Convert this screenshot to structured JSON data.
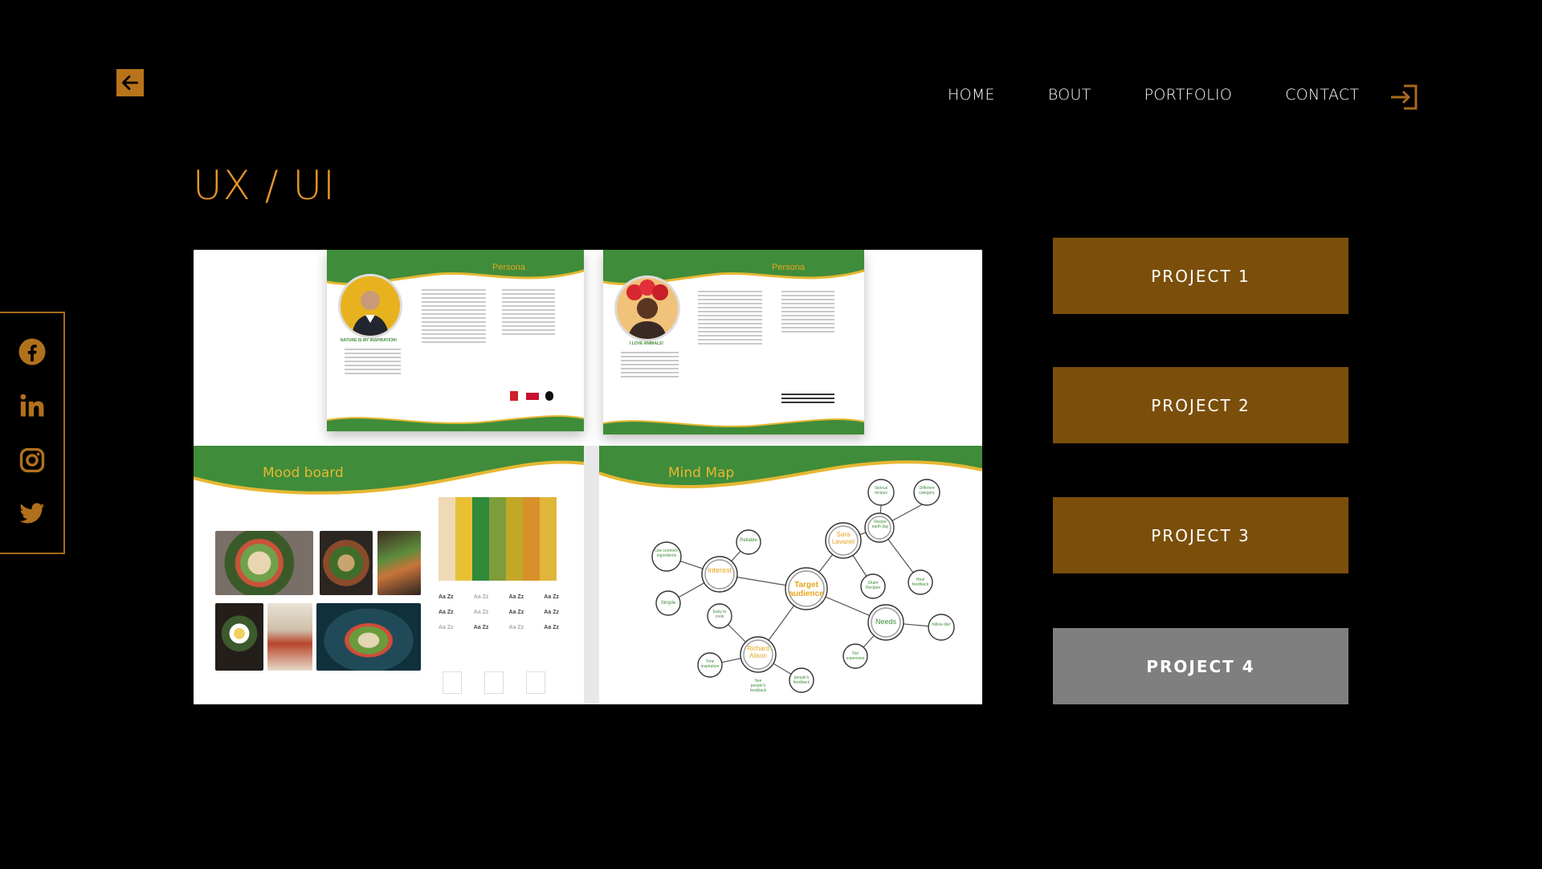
{
  "nav": {
    "items": [
      "HOME",
      "BOUT",
      "PORTFOLIO",
      "CONTACT"
    ]
  },
  "page": {
    "title": "UX / UI"
  },
  "social": [
    "facebook-icon",
    "linkedin-icon",
    "instagram-icon",
    "twitter-icon"
  ],
  "showcase": {
    "persona_label": "Persona",
    "persona1_quote": "NATURE IS MY INSPIRATION!",
    "persona2_quote": "I LOVE ANIMALS!",
    "mood_label": "Mood board",
    "mind_label": "Mind Map",
    "mind_nodes": {
      "center": "Target audience",
      "interest": "Interest",
      "sara": "Sara Lavanel",
      "richard": "Richard Alison",
      "needs": "Needs",
      "reliable": "Reliable",
      "simple": "Simple",
      "use_common": "Use common ingredients",
      "various": "Various recipes",
      "different": "Different category",
      "recipe_every": "Recipe earth day",
      "share": "Share Recipes",
      "heal": "Heal feedback",
      "easy": "Easy to cook",
      "time": "Time inspiration",
      "see": "See people's feedback",
      "peoples": "people's feedback",
      "not": "Not expensive",
      "follow": "follow diet"
    },
    "type_sample": "Aa Zz"
  },
  "projects": [
    {
      "label": "PROJECT 1",
      "active": false
    },
    {
      "label": "PROJECT 2",
      "active": false
    },
    {
      "label": "PROJECT 3",
      "active": false
    },
    {
      "label": "PROJECT 4",
      "active": true
    }
  ],
  "colors": {
    "accent": "#e6952c",
    "project_bg": "#7b4f0b",
    "project_active_bg": "#7f7f7f",
    "brand_green": "#3f8c3a",
    "brand_yellow": "#e6b732"
  }
}
